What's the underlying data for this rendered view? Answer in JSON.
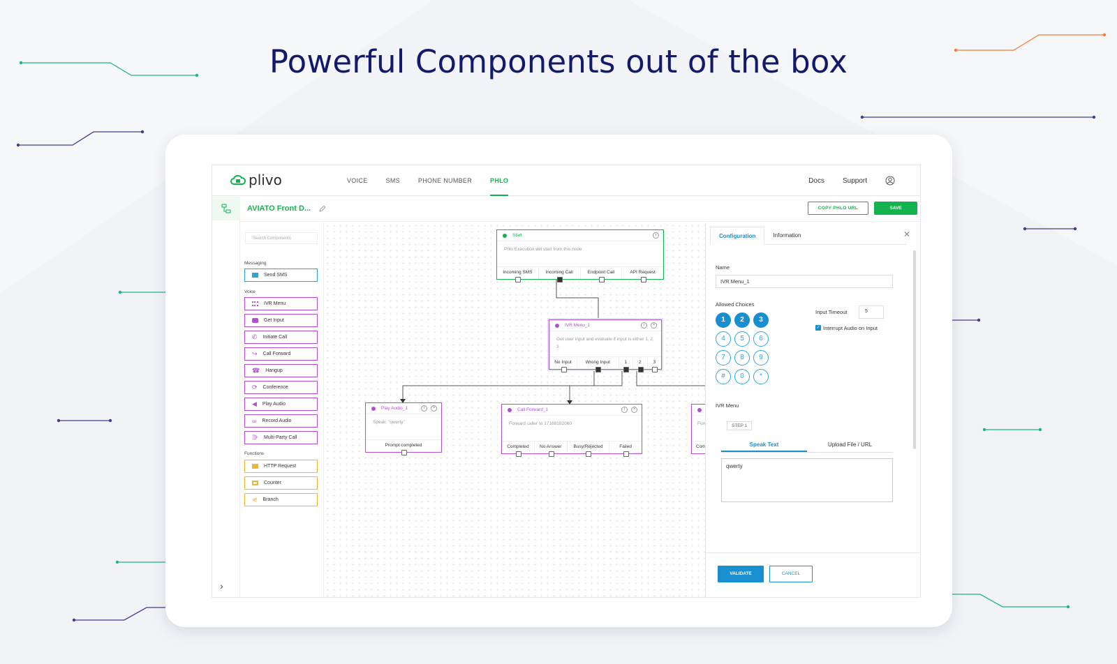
{
  "headline": "Powerful Components out of the box",
  "colors": {
    "brand_green": "#13b44f",
    "accent_blue": "#1a8fd0",
    "voice_purple": "#b34fd1",
    "function_yellow": "#f1b82d",
    "headline_navy": "#141a6b"
  },
  "app": {
    "logo": "plivo",
    "nav": [
      "VOICE",
      "SMS",
      "PHONE NUMBER",
      "PHLO"
    ],
    "nav_active": "PHLO",
    "links": {
      "docs": "Docs",
      "support": "Support"
    },
    "flow_name": "AVIATO Front D...",
    "copy_url": "COPY PHLO URL",
    "save": "SAVE"
  },
  "palette": {
    "search_placeholder": "Search Components",
    "sections": {
      "messaging": "Messaging",
      "voice": "Voice",
      "functions": "Functions"
    },
    "messaging": [
      "Send SMS"
    ],
    "voice": [
      "IVR Menu",
      "Get Input",
      "Initiate Call",
      "Call Forward",
      "Hangup",
      "Conference",
      "Play Audio",
      "Record Audio",
      "Multi-Party Call"
    ],
    "functions": [
      "HTTP Request",
      "Counter",
      "Branch"
    ]
  },
  "canvas": {
    "start": {
      "title": "Start",
      "body": "Phlo Execution will start from this node",
      "ports": [
        "Incoming SMS",
        "Incoming Call",
        "Endpoint Call",
        "API Request"
      ]
    },
    "ivr": {
      "title": "IVR Menu_1",
      "body": "Get user input and evaluate if input is either 1, 2, 3",
      "ports": [
        "No Input",
        "Wrong Input",
        "1",
        "2",
        "3"
      ]
    },
    "play": {
      "title": "Play Audio_1",
      "body": "Speak: \"qwerty\"",
      "ports": [
        "Prompt completed"
      ]
    },
    "forward": {
      "title": "Call Forward_1",
      "body": "Forward caller to 17168192060",
      "ports": [
        "Completed",
        "No Answer",
        "Busy/Rejected",
        "Failed"
      ]
    },
    "partial": {
      "body": "Fon",
      "ports": [
        "Com"
      ]
    }
  },
  "config": {
    "tabs": [
      "Configuration",
      "Information"
    ],
    "name_label": "Name",
    "name_value": "IVR Menu_1",
    "allowed_label": "Allowed Choices",
    "keys": [
      "1",
      "2",
      "3",
      "4",
      "5",
      "6",
      "7",
      "8",
      "9",
      "#",
      "0",
      "*"
    ],
    "selected_keys": [
      "1",
      "2",
      "3"
    ],
    "timeout_label": "Input Timeout",
    "timeout_value": "5",
    "interrupt_label": "Interrupt Audio on Input",
    "interrupt_checked": true,
    "ivr_menu_label": "IVR Menu",
    "step": "STEP 1",
    "inner_tabs": [
      "Speak Text",
      "Upload File / URL"
    ],
    "text_value": "qwerty",
    "validate": "VALIDATE",
    "cancel": "CANCEL"
  }
}
